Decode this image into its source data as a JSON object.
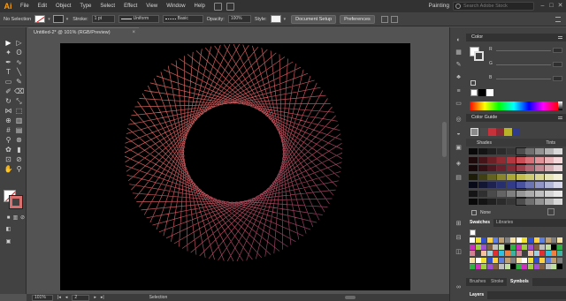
{
  "app": {
    "logo": "Ai",
    "workspace": "Painting",
    "search_placeholder": "Search Adobe Stock"
  },
  "menu": [
    "File",
    "Edit",
    "Object",
    "Type",
    "Select",
    "Effect",
    "View",
    "Window",
    "Help"
  ],
  "control_bar": {
    "selection_label": "No Selection",
    "stroke_label": "Stroke:",
    "stroke_weight": "1 pt",
    "profile": "Uniform",
    "brush": "Basic",
    "opacity_label": "Opacity:",
    "opacity_value": "100%",
    "style_label": "Style:",
    "document_setup": "Document Setup",
    "preferences": "Preferences"
  },
  "document": {
    "tab_title": "Untitled-2* @ 101% (RGB/Preview)"
  },
  "status_bar": {
    "zoom": "101%",
    "artboard_number": "2",
    "tool_name": "Selection"
  },
  "panels": {
    "color": {
      "title": "Color"
    },
    "color_guide": {
      "title": "Color Guide",
      "shades_label": "Shades",
      "tints_label": "Tints",
      "harmony_label": "None"
    },
    "swatches": {
      "tab_swatches": "Swatches",
      "tab_libraries": "Libraries"
    },
    "bottom_tabs": [
      "Brushes",
      "Stroke",
      "Symbols"
    ],
    "layers": {
      "title": "Layers"
    }
  },
  "colors": {
    "artboard": "#000000",
    "pattern_warm": "#e8685e",
    "pattern_cool": "#8a3f6e",
    "logo": "#ff9a00"
  },
  "artwork": {
    "description_shape": "spirograph-ring",
    "spokes": 72
  }
}
